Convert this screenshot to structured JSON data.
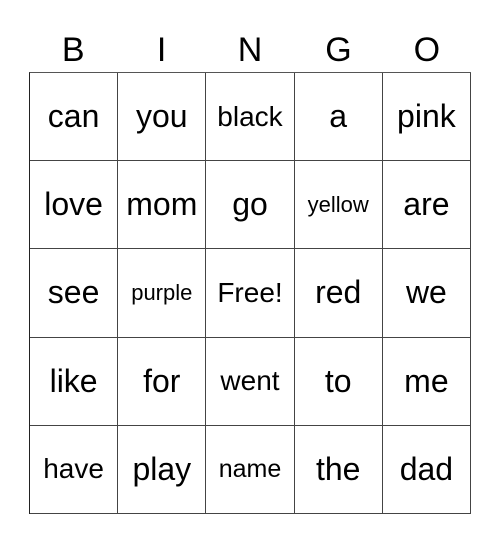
{
  "header": [
    "B",
    "I",
    "N",
    "G",
    "O"
  ],
  "rows": [
    [
      "can",
      "you",
      "black",
      "a",
      "pink"
    ],
    [
      "love",
      "mom",
      "go",
      "yellow",
      "are"
    ],
    [
      "see",
      "purple",
      "Free!",
      "red",
      "we"
    ],
    [
      "like",
      "for",
      "went",
      "to",
      "me"
    ],
    [
      "have",
      "play",
      "name",
      "the",
      "dad"
    ]
  ]
}
